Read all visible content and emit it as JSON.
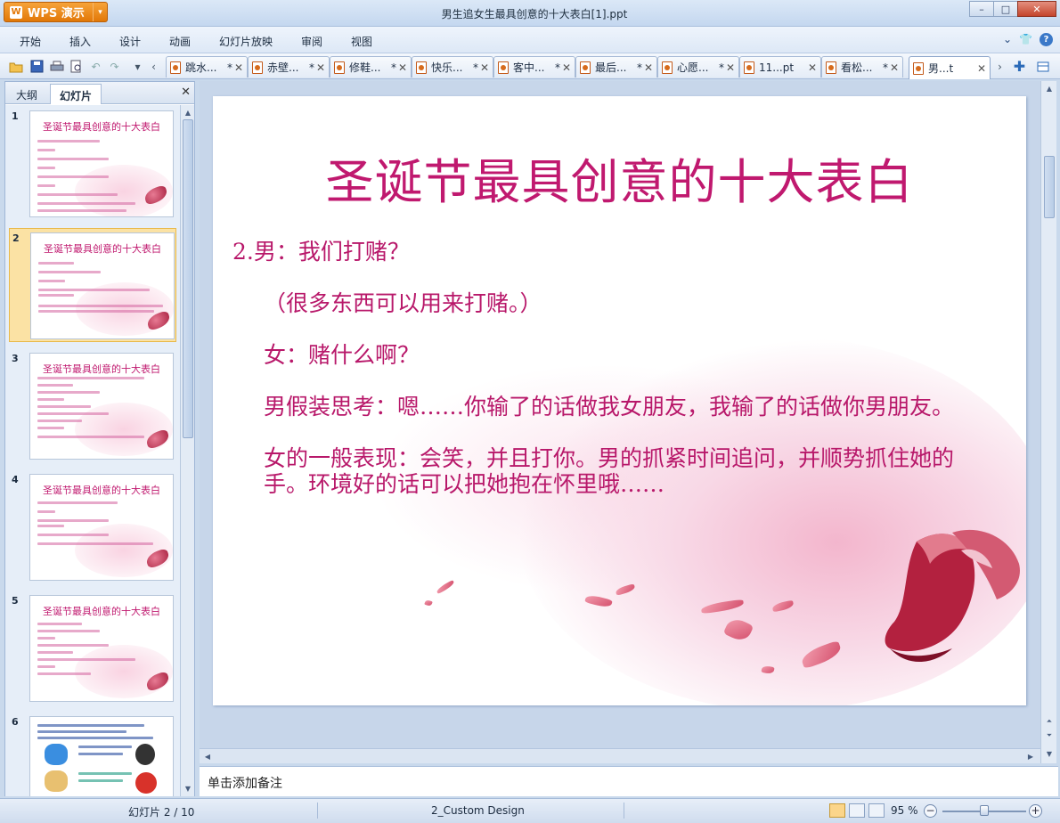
{
  "app": {
    "name": "WPS 演示",
    "logo_letter": "W",
    "doc_title": "男生追女生最具创意的十大表白[1].ppt"
  },
  "window": {
    "minimize": "–",
    "maximize": "□",
    "close": "✕"
  },
  "menu": {
    "items": [
      "开始",
      "插入",
      "设计",
      "动画",
      "幻灯片放映",
      "审阅",
      "视图"
    ],
    "right_icons": [
      "chevron-down-icon",
      "shirt-icon",
      "help-icon"
    ]
  },
  "toolbar": {
    "icons": [
      "open-icon",
      "save-icon",
      "print-icon",
      "print-preview-icon",
      "undo-icon",
      "redo-icon",
      "dropdown-icon",
      "tab-scroll-left-icon"
    ]
  },
  "tabs": [
    {
      "label": "跳水...",
      "mark": "*"
    },
    {
      "label": "赤壁...",
      "mark": "*"
    },
    {
      "label": "修鞋...",
      "mark": "*"
    },
    {
      "label": "快乐...",
      "mark": "*"
    },
    {
      "label": "客中...",
      "mark": "*"
    },
    {
      "label": "最后...",
      "mark": "*"
    },
    {
      "label": "心愿...",
      "mark": "*"
    },
    {
      "label": "11...pt",
      "mark": ""
    },
    {
      "label": "看松...",
      "mark": "*"
    },
    {
      "label": "男...t",
      "mark": ""
    }
  ],
  "tab_close": "✕",
  "left_panel": {
    "tabs": [
      "大纲",
      "幻灯片"
    ],
    "active_tab": 1,
    "close": "✕",
    "slides": [
      {
        "num": "1",
        "title": "圣诞节最具创意的十大表白"
      },
      {
        "num": "2",
        "title": "圣诞节最具创意的十大表白"
      },
      {
        "num": "3",
        "title": "圣诞节最具创意的十大表白"
      },
      {
        "num": "4",
        "title": "圣诞节最具创意的十大表白"
      },
      {
        "num": "5",
        "title": "圣诞节最具创意的十大表白"
      },
      {
        "num": "6",
        "title": ""
      }
    ],
    "selected": 1
  },
  "slide": {
    "title": "圣诞节最具创意的十大表白",
    "paragraphs": [
      "2.男：我们打赌？",
      "（很多东西可以用来打赌。）",
      "女：赌什么啊？",
      "男假装思考：嗯……你输了的话做我女朋友，我输了的话做你男朋友。",
      "女的一般表现：会笑，并且打你。男的抓紧时间追问，并顺势抓住她的手。环境好的话可以把她抱在怀里哦……"
    ]
  },
  "notes": {
    "placeholder": "单击添加备注"
  },
  "status": {
    "slide_info": "幻灯片 2 / 10",
    "design": "2_Custom Design",
    "zoom": "95 %",
    "zoom_out": "−",
    "zoom_in": "+",
    "zoom_level": 0.5
  },
  "colors": {
    "accent": "#c0196f",
    "wps_orange": "#e27808"
  }
}
